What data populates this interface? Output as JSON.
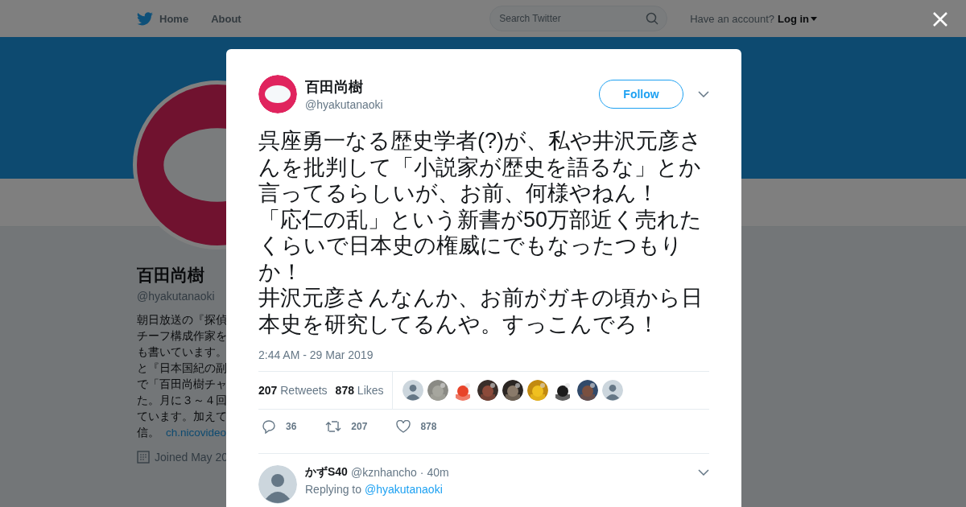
{
  "nav": {
    "home": "Home",
    "about": "About",
    "search_placeholder": "Search Twitter",
    "account_prompt": "Have an account?",
    "login": "Log in"
  },
  "profile": {
    "name": "百田尚樹",
    "handle": "@hyakutanaoki",
    "bio_lines": [
      "朝日放送の『探偵",
      "チーフ構成作家を",
      "も書いています。",
      "と『日本国紀の副",
      "で「百田尚樹チャ",
      "た。月に３～４回",
      "ています。加えて",
      "信。"
    ],
    "bio_link": "ch.nicovideo",
    "joined": "Joined May 20"
  },
  "tweet": {
    "name": "百田尚樹",
    "handle": "@hyakutanaoki",
    "follow": "Follow",
    "paragraphs": [
      "呉座勇一なる歴史学者(?)が、私や井沢元彦さんを批判して「小説家が歴史を語るな」とか言ってるらしいが、お前、何様やねん！",
      "「応仁の乱」という新書が50万部近く売れたくらいで日本史の権威にでもなったつもりか！",
      "井沢元彦さんなんか、お前がガキの頃から日本史を研究してるんや。すっこんでろ！"
    ],
    "time": "2:44 AM - 29 Mar 2019",
    "retweets": "207",
    "retweets_label": "Retweets",
    "likes": "878",
    "likes_label": "Likes",
    "likers": [
      {
        "kind": "default"
      },
      {
        "kind": "picture"
      },
      {
        "kind": "picture"
      },
      {
        "kind": "picture"
      },
      {
        "kind": "picture"
      },
      {
        "kind": "picture"
      },
      {
        "kind": "picture"
      },
      {
        "kind": "picture"
      },
      {
        "kind": "default"
      }
    ],
    "actions": {
      "replies": "36",
      "retweets": "207",
      "likes": "878"
    }
  },
  "reply": {
    "name": "かずS40",
    "handle": "@kznhancho",
    "age": "· 40m",
    "replying_to": "Replying to",
    "mention": "@hyakutanaoki"
  }
}
